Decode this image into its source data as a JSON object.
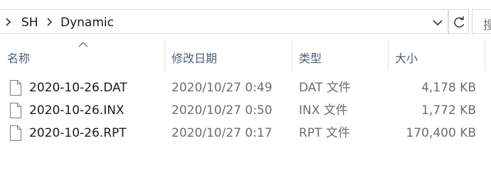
{
  "breadcrumb": {
    "items": [
      {
        "label": "SH"
      },
      {
        "label": "Dynamic"
      }
    ]
  },
  "search": {
    "placeholder": "搜"
  },
  "columns": {
    "name": "名称",
    "modified": "修改日期",
    "type": "类型",
    "size": "大小"
  },
  "files": [
    {
      "name": "2020-10-26.DAT",
      "modified": "2020/10/27 0:49",
      "type": "DAT 文件",
      "size": "4,178 KB"
    },
    {
      "name": "2020-10-26.INX",
      "modified": "2020/10/27 0:50",
      "type": "INX 文件",
      "size": "1,772 KB"
    },
    {
      "name": "2020-10-26.RPT",
      "modified": "2020/10/27 0:17",
      "type": "RPT 文件",
      "size": "170,400 KB"
    }
  ]
}
